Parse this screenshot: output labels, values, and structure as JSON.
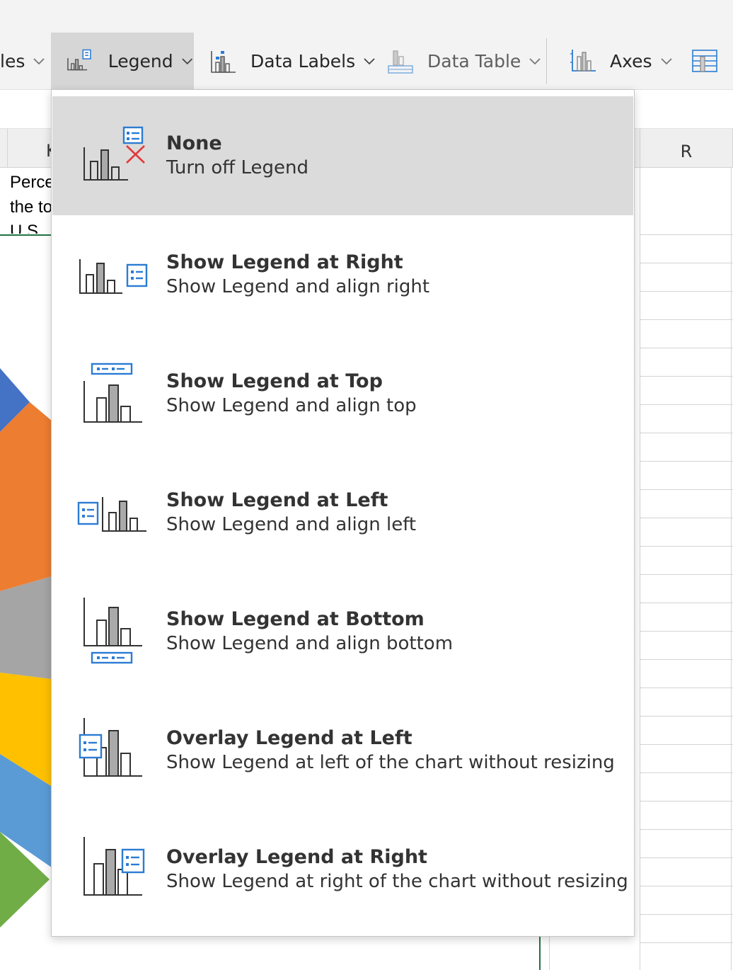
{
  "ribbon": {
    "partial_label": "les",
    "legend_label": "Legend",
    "data_labels_label": "Data Labels",
    "data_table_label": "Data Table",
    "axes_label": "Axes"
  },
  "sheet": {
    "col_k": "K",
    "col_r": "R",
    "cell_line1": "Perce",
    "cell_line2": "the to",
    "cell_line3": "U.S."
  },
  "chart_colors": [
    "#4472c4",
    "#ed7d31",
    "#a5a5a5",
    "#ffc000",
    "#5b9bd5",
    "#70ad47"
  ],
  "menu": {
    "items": [
      {
        "icon": "legend-none-icon",
        "title": "None",
        "desc": "Turn off Legend",
        "selected": true
      },
      {
        "icon": "legend-right-icon",
        "title": "Show Legend at Right",
        "desc": "Show Legend and align right"
      },
      {
        "icon": "legend-top-icon",
        "title": "Show Legend at Top",
        "desc": "Show Legend and align top"
      },
      {
        "icon": "legend-left-icon",
        "title": "Show Legend at Left",
        "desc": "Show Legend and align left"
      },
      {
        "icon": "legend-bottom-icon",
        "title": "Show Legend at Bottom",
        "desc": "Show Legend and align bottom"
      },
      {
        "icon": "overlay-legend-left-icon",
        "title": "Overlay Legend at Left",
        "desc": "Show Legend at left of the chart without resizing"
      },
      {
        "icon": "overlay-legend-right-icon",
        "title": "Overlay Legend at Right",
        "desc": "Show Legend at right of the chart without resizing"
      }
    ]
  }
}
